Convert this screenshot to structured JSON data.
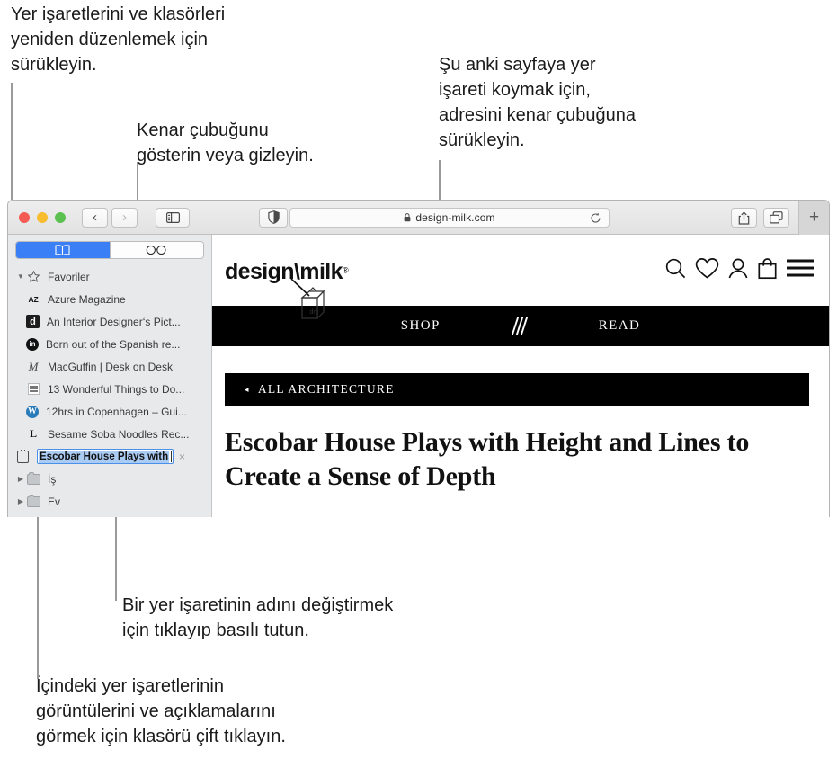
{
  "callouts": {
    "reorder": "Yer işaretlerini ve klasörleri\nyeniden düzenlemek için\nsürükleyin.",
    "sidebar_toggle": "Kenar çubuğunu\ngösterin veya gizleyin.",
    "bookmark_page": "Şu anki sayfaya yer\nişareti koymak için,\nadresini kenar çubuğuna\nsürükleyin.",
    "rename": "Bir yer işaretinin adını değiştirmek\niçin tıklayıp basılı tutun.",
    "folder": "İçindeki yer işaretlerinin\ngörüntülerini ve açıklamalarını\ngörmek için klasörü çift tıklayın."
  },
  "browser": {
    "toolbar": {
      "back_label": "‹",
      "forward_label": "›",
      "sidebar_icon": "sidebar-icon",
      "privacy_icon": "privacy-report-icon",
      "reader_icon": "reader-view-icon",
      "share_icon": "share-icon",
      "tab_overview_icon": "tab-overview-icon",
      "new_tab_label": "+"
    },
    "url": {
      "value": "design-milk.com",
      "lock_icon": "lock-icon",
      "reload_icon": "reload-icon"
    },
    "sidebar": {
      "segments": [
        {
          "name": "bookmarks",
          "icon": "book-icon",
          "active": true
        },
        {
          "name": "reading-list",
          "icon": "glasses-icon",
          "active": false
        }
      ],
      "group_label": "Favoriler",
      "items": [
        {
          "favicon": "az",
          "label": "Azure Magazine"
        },
        {
          "favicon": "d",
          "label": "An Interior Designer‘s Pict..."
        },
        {
          "favicon": "in",
          "label": "Born out of the Spanish re..."
        },
        {
          "favicon": "m",
          "label": "MacGuffin | Desk on Desk"
        },
        {
          "favicon": "grid",
          "label": "13 Wonderful Things to Do..."
        },
        {
          "favicon": "wp",
          "label": "12hrs in Copenhagen – Gui..."
        },
        {
          "favicon": "l",
          "label": "Sesame Soba Noodles Rec..."
        }
      ],
      "editing_item": {
        "favicon": "kite",
        "value": "Escobar House Plays with",
        "close_label": "×"
      },
      "folders": [
        {
          "label": "İş"
        },
        {
          "label": "Ev"
        }
      ]
    }
  },
  "page": {
    "logo": {
      "text": "design\\milk",
      "registered": "®",
      "carton_label": "dm"
    },
    "site_icons": [
      "search-icon",
      "heart-icon",
      "account-icon",
      "shopping-bag-icon",
      "menu-icon"
    ],
    "nav": {
      "left": "SHOP",
      "mark": "slashes-logo",
      "right": "READ"
    },
    "breadcrumb": {
      "arrow": "◂",
      "label": "ALL ARCHITECTURE"
    },
    "headline": "Escobar House Plays with Height and Lines to Create a Sense of Depth"
  }
}
